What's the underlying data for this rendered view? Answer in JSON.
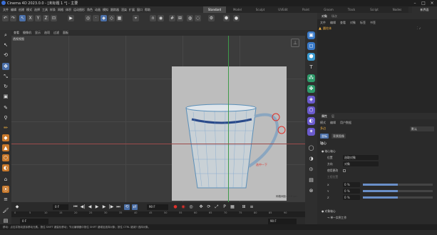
{
  "titlebar": {
    "title": "Cinema 4D 2023.0.0 - [未标题 1 *] - 主要"
  },
  "layout_tabs": [
    "Standard",
    "Model",
    "Sculpt",
    "UVEdit",
    "Paint",
    "Groom",
    "Track",
    "Script",
    "Nodes"
  ],
  "active_layout": "Standard",
  "new_layout": "新界面",
  "menus": [
    "文件",
    "编辑",
    "创建",
    "模式",
    "选择",
    "工具",
    "样条",
    "网格",
    "体积",
    "运动图形",
    "角色",
    "动画",
    "模拟",
    "跟踪器",
    "渲染",
    "扩展",
    "窗口",
    "帮助"
  ],
  "viewport_menu": [
    "查看",
    "摄像机",
    "显示",
    "选项",
    "过滤",
    "面板"
  ],
  "viewport_label": "透视视图",
  "plane_label": "网格间距：0.5 cm",
  "annotation_text": "选中一下",
  "timeline": {
    "frame_current": "0 F",
    "frame_start": "0 F",
    "frame_end": "90 F",
    "frame_field_right": "90 F",
    "ticks": [
      "0",
      "5",
      "10",
      "15",
      "20",
      "25",
      "30",
      "35",
      "40",
      "45",
      "50",
      "55",
      "60",
      "65",
      "70",
      "75",
      "80",
      "85",
      "90"
    ]
  },
  "status_text": "移动：点击并拖动鼠标移动元素。按住 SHIFT 键量化移动；节点编辑器中按住 SHIFT 键增加选择对象；按住 CTRL 键减少选择对象。",
  "object_panel": {
    "tabs": [
      "对象",
      "场次"
    ],
    "menu": [
      "文件",
      "编辑",
      "查看",
      "对象",
      "标签",
      "书签"
    ],
    "object_name": "圆柱体"
  },
  "attr_panel": {
    "tabs": [
      "属性",
      "层"
    ],
    "menu": [
      "模式",
      "编辑",
      "用户数据"
    ],
    "mode_label": "多边",
    "mode_select": "默认",
    "basic_tab": "坐标",
    "basic_tab2": "背景图像",
    "section": "轴心",
    "rows": [
      {
        "label": "● 轴心轴心",
        "value": ""
      },
      {
        "label": "位置",
        "value": "选取对象"
      },
      {
        "label": "方向",
        "value": "对象"
      },
      {
        "label": "使用更改",
        "value": ""
      },
      {
        "label": "工程位置",
        "value": ""
      },
      {
        "label": "X",
        "value": "0 %"
      },
      {
        "label": "Y",
        "value": "0 %"
      },
      {
        "label": "Z",
        "value": "0 %"
      },
      {
        "label": "● 对象轴心",
        "value": ""
      },
      {
        "label": "→ 单一实例工作",
        "value": ""
      }
    ]
  },
  "colors": {
    "accent": "#4a6fa8",
    "selection": "#f0b040",
    "annotation": "#e0302a"
  }
}
